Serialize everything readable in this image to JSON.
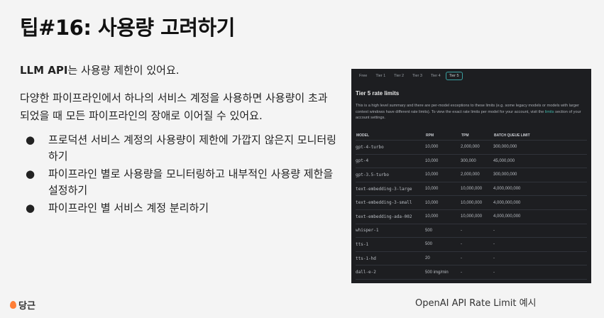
{
  "slide": {
    "title": "팁#16: 사용량 고려하기",
    "p1_bold": "LLM API",
    "p1_rest": "는 사용량 제한이 있어요.",
    "p2": "다양한 파이프라인에서 하나의 서비스 계정을 사용하면 사용량이 초과되었을 때 모든 파이프라인의 장애로 이어질 수 있어요.",
    "bullets": [
      {
        "dot": "●",
        "text": "프로덕션 서비스 계정의 사용량이 제한에 가깝지 않은지 모니터링 하기"
      },
      {
        "dot": "●",
        "text": "파이프라인 별로 사용량을 모니터링하고 내부적인 사용량 제한을 설정하기"
      },
      {
        "dot": "●",
        "text": "파이프라인 별 서비스 계정 분리하기"
      }
    ],
    "logo": "당근",
    "caption": "OpenAI API Rate Limit 예시"
  },
  "panel": {
    "tabs": [
      "Free",
      "Tier 1",
      "Tier 2",
      "Tier 3",
      "Tier 4",
      "Tier 5"
    ],
    "active_tab": "Tier 5",
    "heading": "Tier 5 rate limits",
    "desc_pre": "This is a high level summary and there are per-model exceptions to these limits (e.g. some legacy models or models with larger context windows have different rate limits). To view the exact rate limits per model for your account, visit the ",
    "desc_link": "limits",
    "desc_post": " section of your account settings.",
    "columns": [
      "MODEL",
      "RPM",
      "TPM",
      "BATCH QUEUE LIMIT"
    ],
    "rows": [
      [
        "gpt-4-turbo",
        "10,000",
        "2,000,000",
        "300,000,000"
      ],
      [
        "gpt-4",
        "10,000",
        "300,000",
        "45,000,000"
      ],
      [
        "gpt-3.5-turbo",
        "10,000",
        "2,000,000",
        "300,000,000"
      ],
      [
        "text-embedding-3-large",
        "10,000",
        "10,000,000",
        "4,000,000,000"
      ],
      [
        "text-embedding-3-small",
        "10,000",
        "10,000,000",
        "4,000,000,000"
      ],
      [
        "text-embedding-ada-002",
        "10,000",
        "10,000,000",
        "4,000,000,000"
      ],
      [
        "whisper-1",
        "500",
        "-",
        "-"
      ],
      [
        "tts-1",
        "500",
        "-",
        "-"
      ],
      [
        "tts-1-hd",
        "20",
        "-",
        "-"
      ],
      [
        "dall-e-2",
        "500 img/min",
        "-",
        "-"
      ],
      [
        "dall-e-3",
        "50 img/min",
        "-",
        "-"
      ]
    ]
  }
}
